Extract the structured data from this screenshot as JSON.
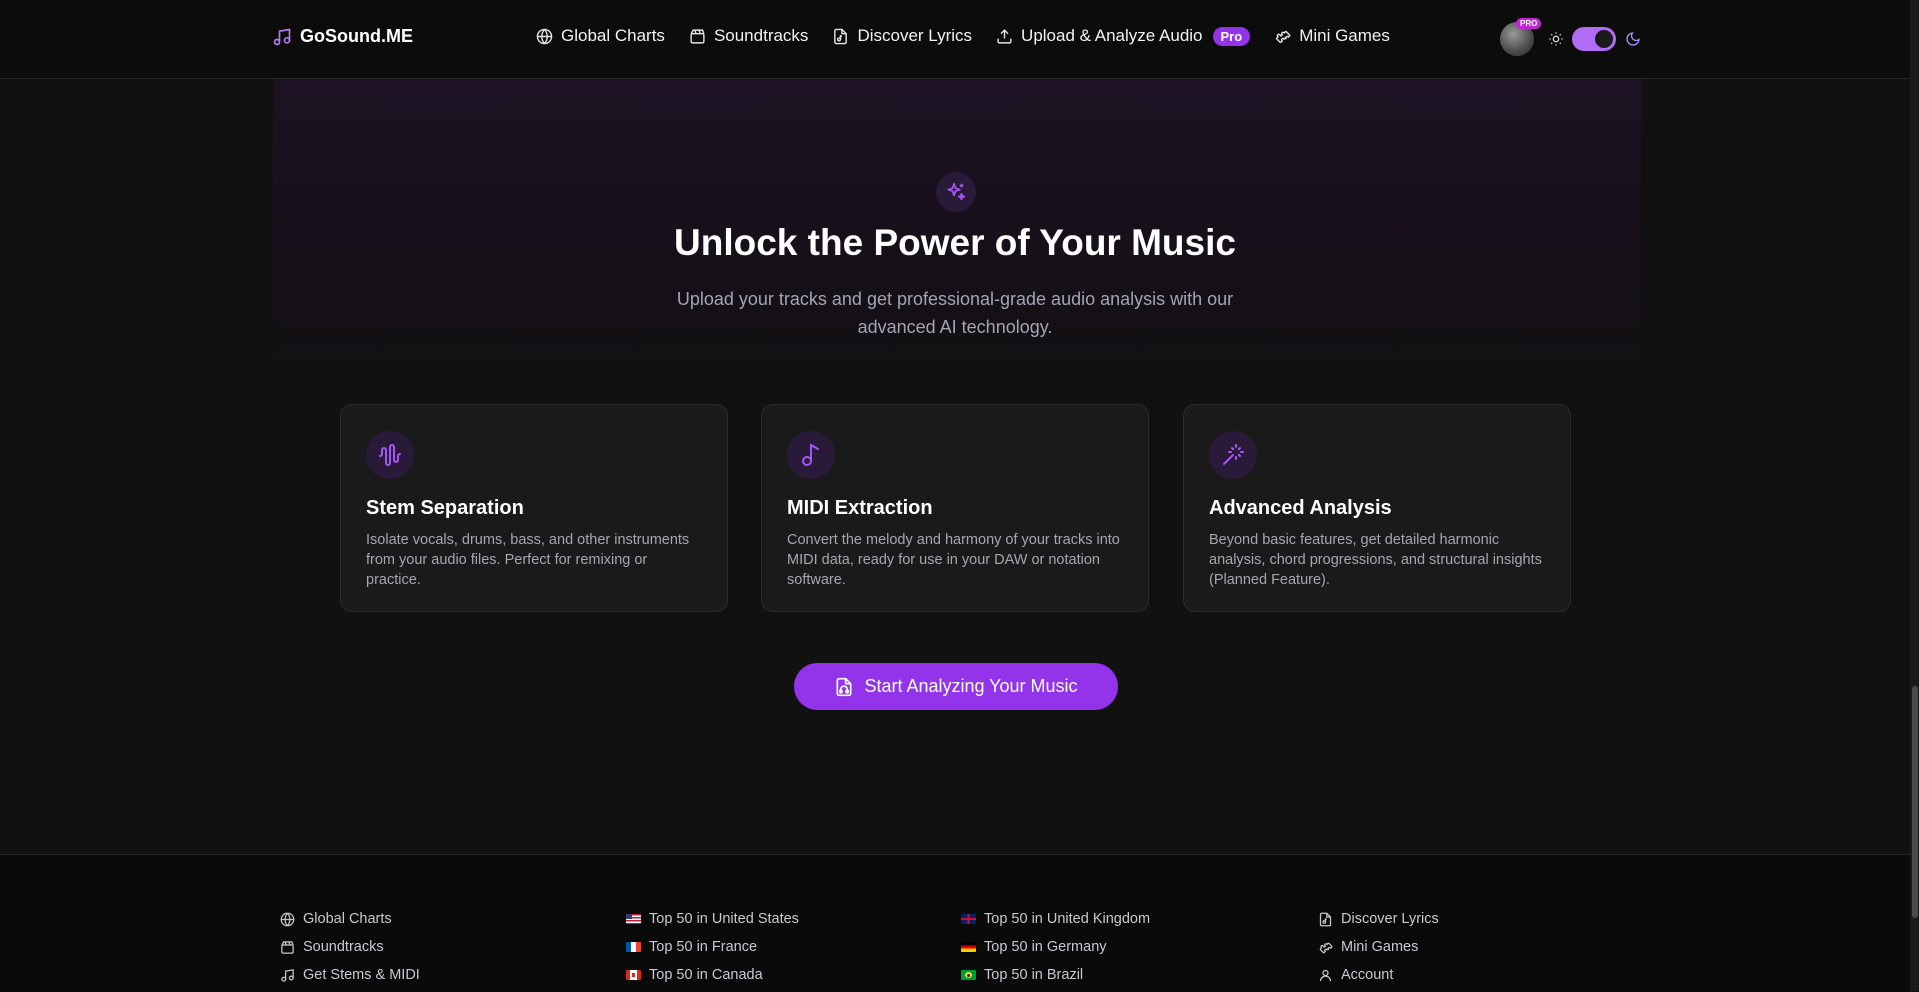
{
  "header": {
    "logo_text": "GoSound.ME",
    "nav": [
      {
        "label": "Global Charts",
        "icon": "globe-icon"
      },
      {
        "label": "Soundtracks",
        "icon": "clapperboard-icon"
      },
      {
        "label": "Discover Lyrics",
        "icon": "file-music-icon"
      },
      {
        "label": "Upload & Analyze Audio",
        "icon": "upload-icon",
        "badge": "Pro"
      },
      {
        "label": "Mini Games",
        "icon": "puzzle-icon"
      }
    ],
    "avatar_badge": "PRO",
    "theme_toggle": "dark"
  },
  "hero": {
    "title": "Unlock the Power of Your Music",
    "subtitle": "Upload your tracks and get professional-grade audio analysis with our advanced AI technology."
  },
  "features": [
    {
      "title": "Stem Separation",
      "description": "Isolate vocals, drums, bass, and other instruments from your audio files. Perfect for remixing or practice.",
      "icon": "waveform-icon"
    },
    {
      "title": "MIDI Extraction",
      "description": "Convert the melody and harmony of your tracks into MIDI data, ready for use in your DAW or notation software.",
      "icon": "music-note-icon"
    },
    {
      "title": "Advanced Analysis",
      "description": "Beyond basic features, get detailed harmonic analysis, chord progressions, and structural insights (Planned Feature).",
      "icon": "magic-wand-icon"
    }
  ],
  "cta": {
    "label": "Start Analyzing Your Music",
    "icon": "file-audio-icon"
  },
  "footer": {
    "col1": [
      {
        "label": "Global Charts",
        "icon": "globe-icon"
      },
      {
        "label": "Soundtracks",
        "icon": "clapperboard-icon"
      },
      {
        "label": "Get Stems & MIDI",
        "icon": "music-icon"
      }
    ],
    "col2": [
      {
        "label": "Top 50 in United States",
        "icon": "us-flag-icon"
      },
      {
        "label": "Top 50 in France",
        "icon": "fr-flag-icon"
      },
      {
        "label": "Top 50 in Canada",
        "icon": "ca-flag-icon"
      }
    ],
    "col3": [
      {
        "label": "Top 50 in United Kingdom",
        "icon": "uk-flag-icon"
      },
      {
        "label": "Top 50 in Germany",
        "icon": "de-flag-icon"
      },
      {
        "label": "Top 50 in Brazil",
        "icon": "br-flag-icon"
      }
    ],
    "col4": [
      {
        "label": "Discover Lyrics",
        "icon": "file-music-icon"
      },
      {
        "label": "Mini Games",
        "icon": "puzzle-icon"
      },
      {
        "label": "Account",
        "icon": "user-icon"
      }
    ]
  },
  "colors": {
    "accent": "#9333ea",
    "background": "#111111",
    "card": "#1a1a1a",
    "toggle": "#b06cf5"
  }
}
